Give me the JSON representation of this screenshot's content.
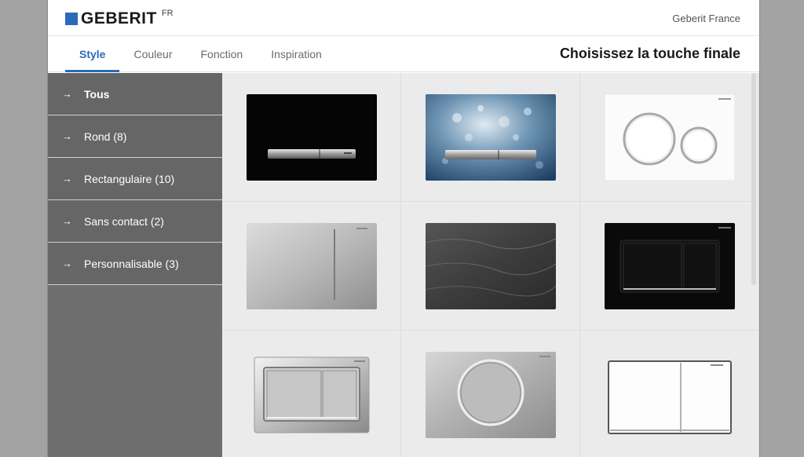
{
  "header": {
    "brand": "GEBERIT",
    "brand_suffix": "FR",
    "country": "Geberit France"
  },
  "tabs": [
    {
      "label": "Style",
      "active": true
    },
    {
      "label": "Couleur",
      "active": false
    },
    {
      "label": "Fonction",
      "active": false
    },
    {
      "label": "Inspiration",
      "active": false
    }
  ],
  "heading": "Choisissez la touche finale",
  "sidebar": {
    "items": [
      {
        "label": "Tous",
        "active": true
      },
      {
        "label": "Rond (8)",
        "active": false
      },
      {
        "label": "Rectangulaire (10)",
        "active": false
      },
      {
        "label": "Sans contact (2)",
        "active": false
      },
      {
        "label": "Personnalisable (3)",
        "active": false
      }
    ]
  },
  "products": [
    {
      "icon": "black-plate-slim-buttons-icon"
    },
    {
      "icon": "water-pattern-plate-icon"
    },
    {
      "icon": "white-plate-round-buttons-icon"
    },
    {
      "icon": "brushed-steel-plate-icon"
    },
    {
      "icon": "slate-stone-plate-icon"
    },
    {
      "icon": "black-plate-dual-buttons-icon"
    },
    {
      "icon": "chrome-plate-dual-buttons-icon"
    },
    {
      "icon": "steel-plate-round-button-icon"
    },
    {
      "icon": "white-glass-plate-icon"
    }
  ],
  "colors": {
    "accent": "#2a6ab8",
    "sidebar_bg": "#666666"
  }
}
